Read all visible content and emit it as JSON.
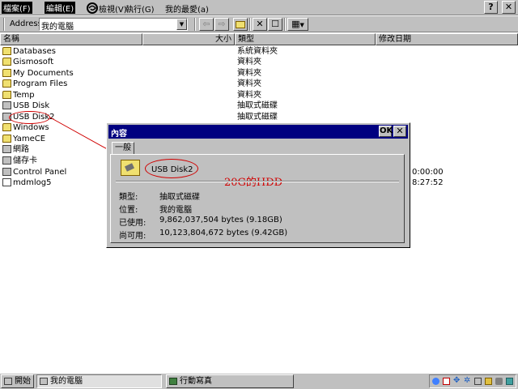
{
  "menu": {
    "items": [
      "檔案(F)",
      "編輯(E)",
      "檢視(V)",
      "執行(G)",
      "我的最愛(a)"
    ],
    "help_label": "?",
    "close_label": "✕"
  },
  "toolbar": {
    "address_label": "Address",
    "address_value": "我的電腦",
    "back": "⇦",
    "forward": "⇨",
    "up": "⇧",
    "delete": "✕",
    "properties": "☐",
    "views": "▦"
  },
  "columns": [
    "名稱",
    "大小",
    "類型",
    "修改日期"
  ],
  "files": [
    {
      "name": "Databases",
      "type": "系統資料夾",
      "date": "",
      "icon": "database-folder"
    },
    {
      "name": "Gismosoft",
      "type": "資料夾",
      "date": "",
      "icon": "folder"
    },
    {
      "name": "My Documents",
      "type": "資料夾",
      "date": "",
      "icon": "folder"
    },
    {
      "name": "Program Files",
      "type": "資料夾",
      "date": "",
      "icon": "folder"
    },
    {
      "name": "Temp",
      "type": "資料夾",
      "date": "",
      "icon": "folder"
    },
    {
      "name": "USB Disk",
      "type": "抽取式磁碟",
      "date": "",
      "icon": "drive"
    },
    {
      "name": "USB Disk2",
      "type": "抽取式磁碟",
      "date": "",
      "icon": "drive"
    },
    {
      "name": "Windows",
      "type": "",
      "date": "",
      "icon": "folder"
    },
    {
      "name": "YameCE",
      "type": "",
      "date": "",
      "icon": "folder"
    },
    {
      "name": "網路",
      "type": "",
      "date": "",
      "icon": "network-folder"
    },
    {
      "name": "儲存卡",
      "type": "",
      "date": "",
      "icon": "storage-card"
    },
    {
      "name": "Control Panel",
      "type": "",
      "date": "0:00:00",
      "icon": "control-panel"
    },
    {
      "name": "mdmlog5",
      "type": "",
      "date": "8:27:52",
      "icon": "file"
    }
  ],
  "dialog": {
    "title": "內容",
    "ok_label": "OK",
    "close_label": "✕",
    "tab_label": "一般",
    "drive_name": "USB Disk2",
    "annotation": "20G的HDD",
    "properties": [
      {
        "label": "類型:",
        "value": "抽取式磁碟"
      },
      {
        "label": "位置:",
        "value": "我的電腦"
      },
      {
        "label": "已使用:",
        "value": "9,862,037,504 bytes (9.18GB)"
      },
      {
        "label": "尚可用:",
        "value": "10,123,804,672 bytes (9.42GB)"
      }
    ]
  },
  "taskbar": {
    "start_label": "開始",
    "tasks": [
      "我的電腦",
      "行動寫真"
    ]
  },
  "colors": {
    "annotation_red": "#d00000",
    "title_bar": "#000080",
    "chrome": "#c0c0c0"
  }
}
